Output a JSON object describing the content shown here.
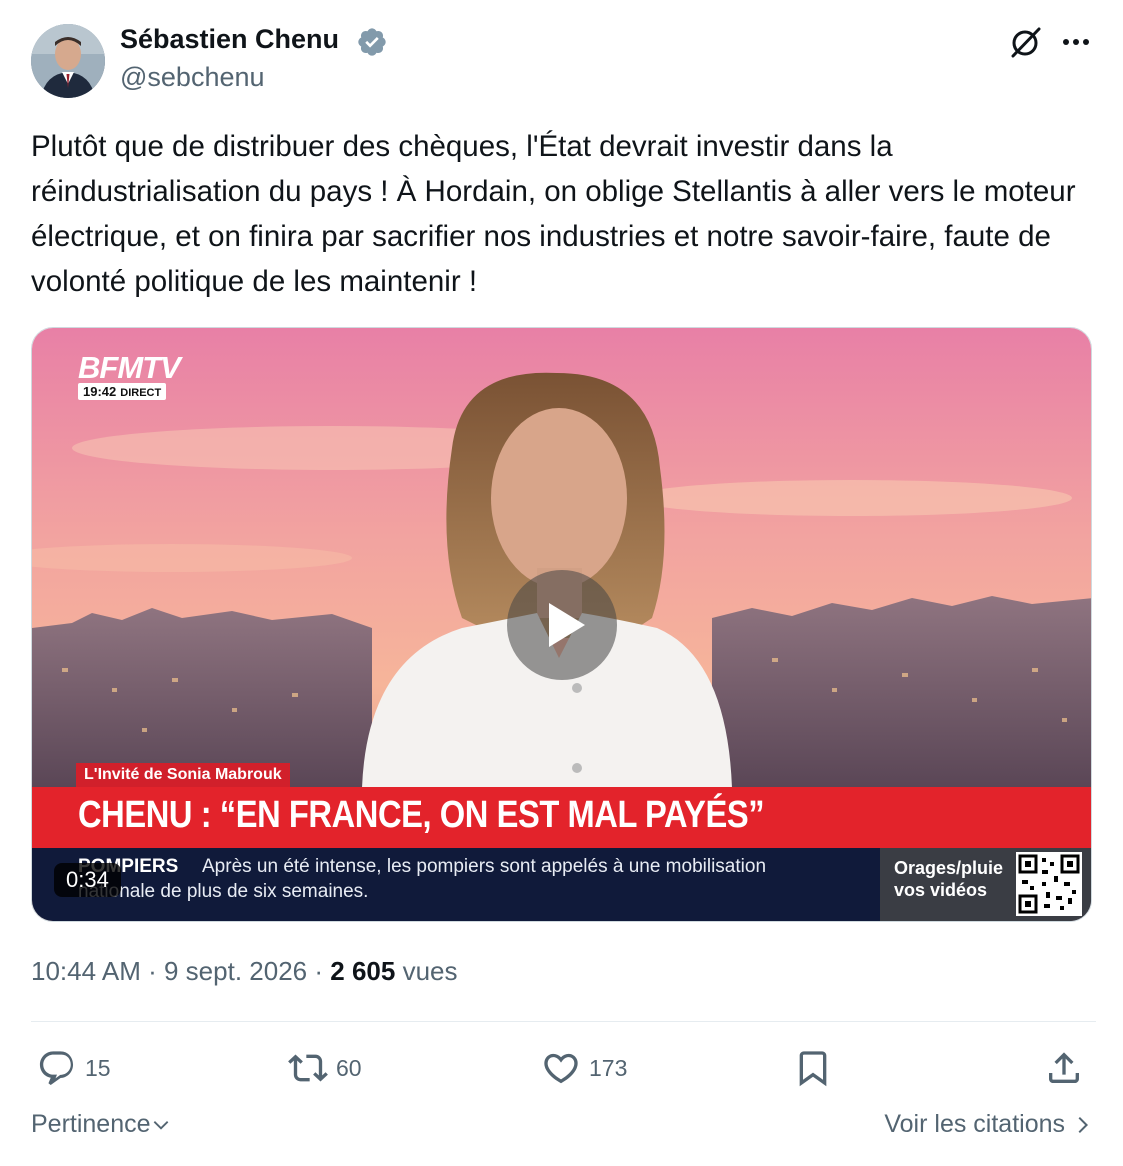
{
  "author": {
    "name": "Sébastien Chenu",
    "handle": "@sebchenu",
    "verified": true
  },
  "tweet": {
    "text": "Plutôt que de distribuer des chèques, l'État devrait investir dans la réindustrialisation du pays ! À Hordain, on oblige Stellantis à aller vers le moteur électrique, et on finira par sacrifier nos industries et notre savoir-faire, faute de volonté politique de les maintenir !"
  },
  "video": {
    "duration": "0:34",
    "channel_logo": "BFMTV",
    "channel_time": "19:42",
    "channel_live": "DIRECT",
    "show_tag": "L'Invité de Sonia Mabrouk",
    "headline": "CHENU : “EN FRANCE, ON EST MAL PAYÉS”",
    "ticker_label": "POMPIERS",
    "ticker_line1": "Après un été intense, les pompiers sont appelés à une mobilisation",
    "ticker_line2": "nationale de plus de six semaines.",
    "weather_text": "Orages/pluie vos vidéos"
  },
  "meta": {
    "time": "10:44 AM",
    "sep": "·",
    "date": "9 sept. 2026",
    "views_count": "2 605",
    "views_label": "vues"
  },
  "actions": {
    "replies": "15",
    "reposts": "60",
    "likes": "173"
  },
  "footer": {
    "sort_label": "Pertinence",
    "quotes_label": "Voir les citations"
  },
  "colors": {
    "verified": "#829aab",
    "text_secondary": "#536471",
    "bfm_red": "#e3232b",
    "ticker_navy": "#101a3a"
  },
  "icons": [
    "grok-icon",
    "more-icon",
    "verified-badge-icon",
    "play-icon",
    "reply-icon",
    "repost-icon",
    "like-icon",
    "bookmark-icon",
    "share-icon",
    "chevron-down-icon",
    "chevron-right-icon"
  ]
}
